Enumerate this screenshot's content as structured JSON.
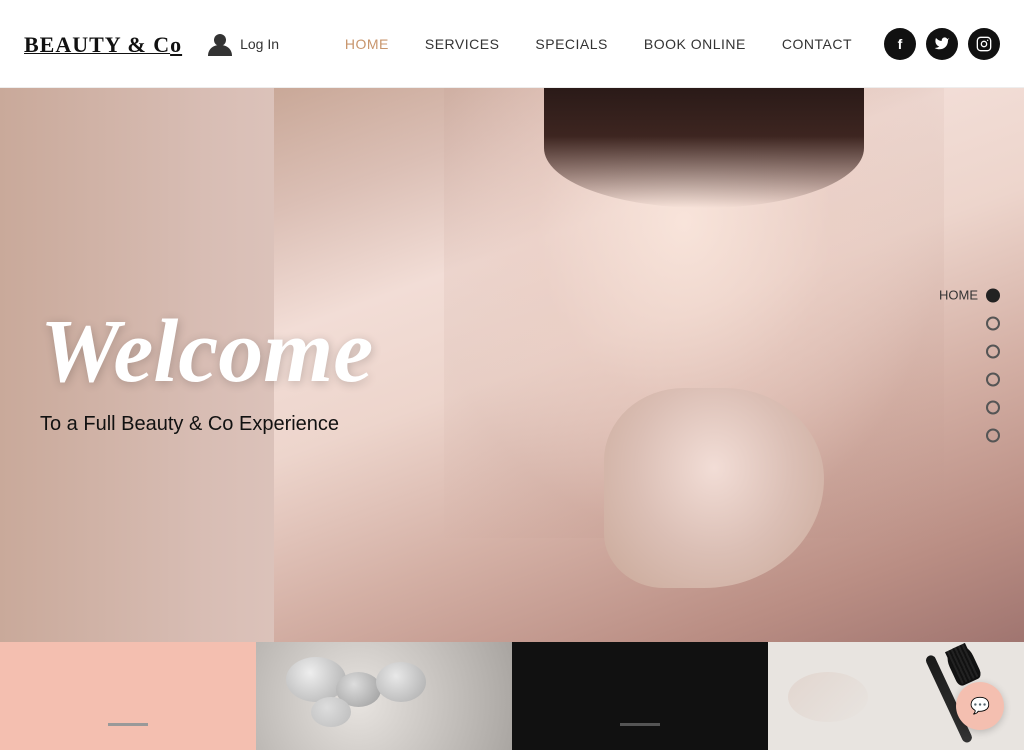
{
  "header": {
    "logo": "BEAUTY & C",
    "logo_o": "o",
    "login_label": "Log In",
    "nav": [
      {
        "id": "home",
        "label": "HOME",
        "active": true
      },
      {
        "id": "services",
        "label": "SERVICES",
        "active": false
      },
      {
        "id": "specials",
        "label": "SPECIALS",
        "active": false
      },
      {
        "id": "book_online",
        "label": "BOOK ONLINE",
        "active": false
      },
      {
        "id": "contact",
        "label": "CONTACT",
        "active": false
      }
    ],
    "social": [
      {
        "id": "facebook",
        "symbol": "f"
      },
      {
        "id": "twitter",
        "symbol": "t"
      },
      {
        "id": "instagram",
        "symbol": "in"
      }
    ]
  },
  "hero": {
    "welcome_text": "Welcome",
    "subtitle": "To a Full Beauty & Co Experience",
    "side_nav": [
      {
        "label": "HOME",
        "active": true
      },
      {
        "label": "",
        "active": false
      },
      {
        "label": "",
        "active": false
      },
      {
        "label": "",
        "active": false
      },
      {
        "label": "",
        "active": false
      },
      {
        "label": "",
        "active": false
      }
    ]
  },
  "chat_button": {
    "symbol": "···"
  }
}
